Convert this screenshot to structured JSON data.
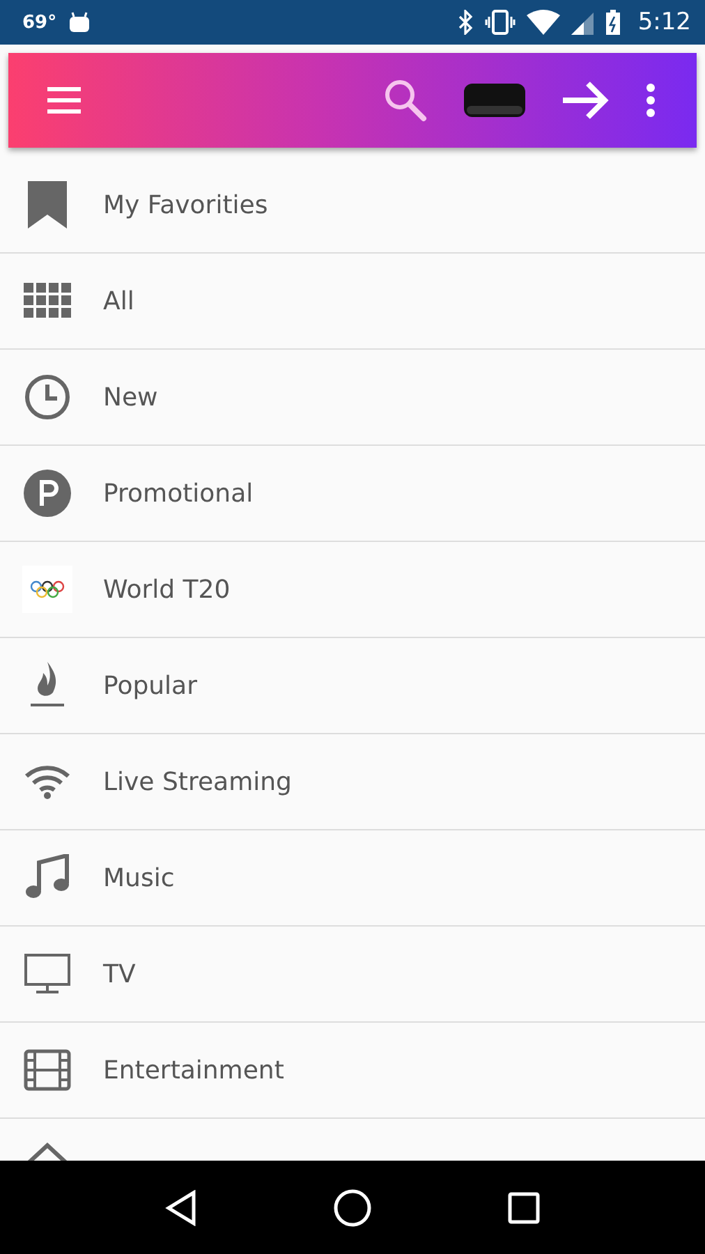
{
  "status_bar": {
    "temperature": "69°",
    "time": "5:12"
  },
  "menu": [
    {
      "label": "My Favorities",
      "kind": "bookmark"
    },
    {
      "label": "All",
      "kind": "grid"
    },
    {
      "label": "New",
      "kind": "clock"
    },
    {
      "label": "Promotional",
      "kind": "promo"
    },
    {
      "label": "World T20",
      "kind": "rings"
    },
    {
      "label": "Popular",
      "kind": "flame"
    },
    {
      "label": "Live Streaming",
      "kind": "wifi"
    },
    {
      "label": "Music",
      "kind": "music"
    },
    {
      "label": "TV",
      "kind": "tv"
    },
    {
      "label": "Entertainment",
      "kind": "film"
    }
  ]
}
